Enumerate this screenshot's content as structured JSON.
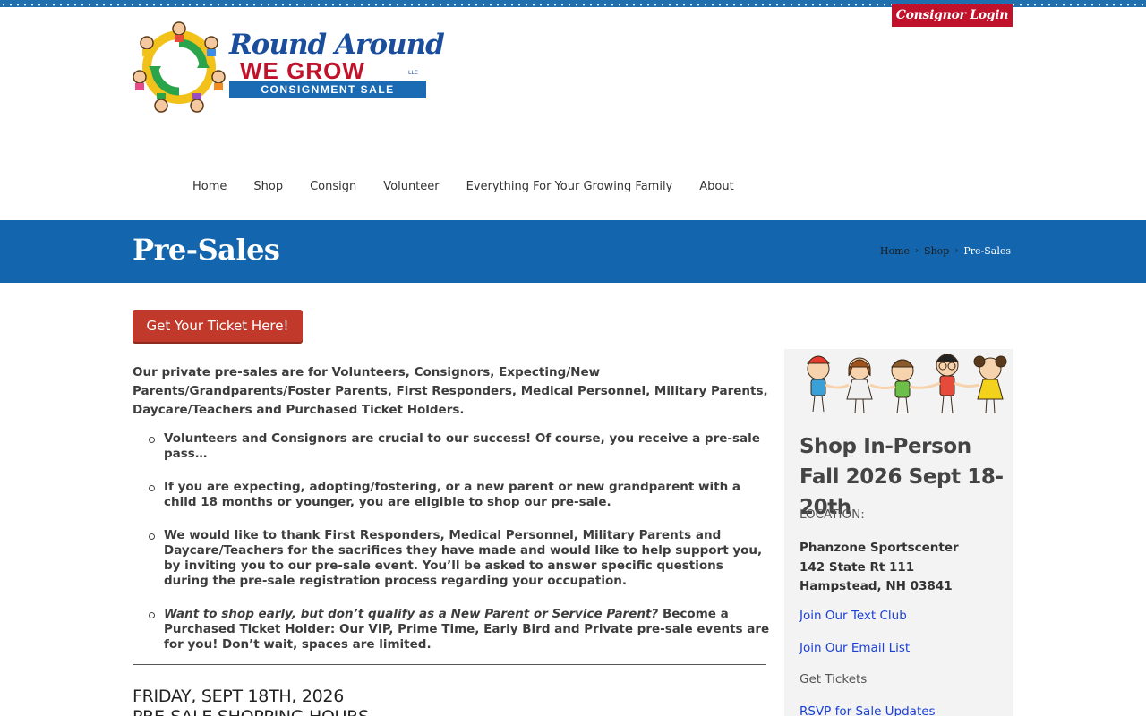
{
  "header": {
    "consignor_login": "Consignor Login",
    "logo": {
      "line1": "Round Around",
      "line2": "WE GROW",
      "llc": "LLC",
      "band": "CONSIGNMENT SALE"
    }
  },
  "nav": {
    "items": [
      {
        "label": "Home"
      },
      {
        "label": "Shop"
      },
      {
        "label": "Consign"
      },
      {
        "label": "Volunteer"
      },
      {
        "label": "Everything For Your Growing Family"
      },
      {
        "label": "About"
      }
    ]
  },
  "banner": {
    "title": "Pre-Sales",
    "breadcrumb": [
      "Home",
      "Shop",
      "Pre-Sales"
    ],
    "separator": "›"
  },
  "main": {
    "ticket_button": "Get Your Ticket Here!",
    "intro": "Our private pre-sales are for Volunteers, Consignors, Expecting/New Parents/Grandparents/Foster Parents, First Responders, Medical Personnel, Military Parents, Daycare/Teachers and Purchased Ticket Holders.",
    "bullets": [
      "Volunteers and Consignors are crucial to our success! Of course, you receive a pre-sale pass…",
      "If you are expecting, adopting/fostering, or a new parent or new grandparent with a child 18 months or younger, you are eligible to shop our pre-sale.",
      "We would like to thank First Responders, Medical Personnel, Military Parents and Daycare/Teachers for the sacrifices they have made and would like to help support you, by inviting you to our pre-sale event. You’ll be asked to answer specific questions during the pre-sale registration process regarding your occupation."
    ],
    "bullet4_italic": "Want to shop early, but don’t qualify as a New Parent or Service Parent?",
    "bullet4_rest": " Become a Purchased Ticket Holder: Our VIP, Prime Time, Early Bird and Private pre-sale events are for you! Don’t wait, spaces are limited.",
    "event_date": "FRIDAY, SEPT 18TH, 2026",
    "event_sub": "PRE-SALE SHOPPING HOURS"
  },
  "sidebar": {
    "title": "Shop In-Person Fall 2026 Sept 18-20th",
    "location_label": "LOCATION:",
    "address_line1": "Phanzone Sportscenter",
    "address_line2": "142 State Rt 111",
    "address_line3": "Hampstead, NH 03841",
    "text_club": "Join Our Text Club",
    "email_list": "Join Our Email List",
    "get_tickets": "Get Tickets",
    "rsvp": "RSVP for Sale Updates"
  },
  "colors": {
    "brand_blue": "#1366ad",
    "brand_red": "#c0122b",
    "button_red": "#c0392b",
    "link_blue": "#1a40d6"
  }
}
